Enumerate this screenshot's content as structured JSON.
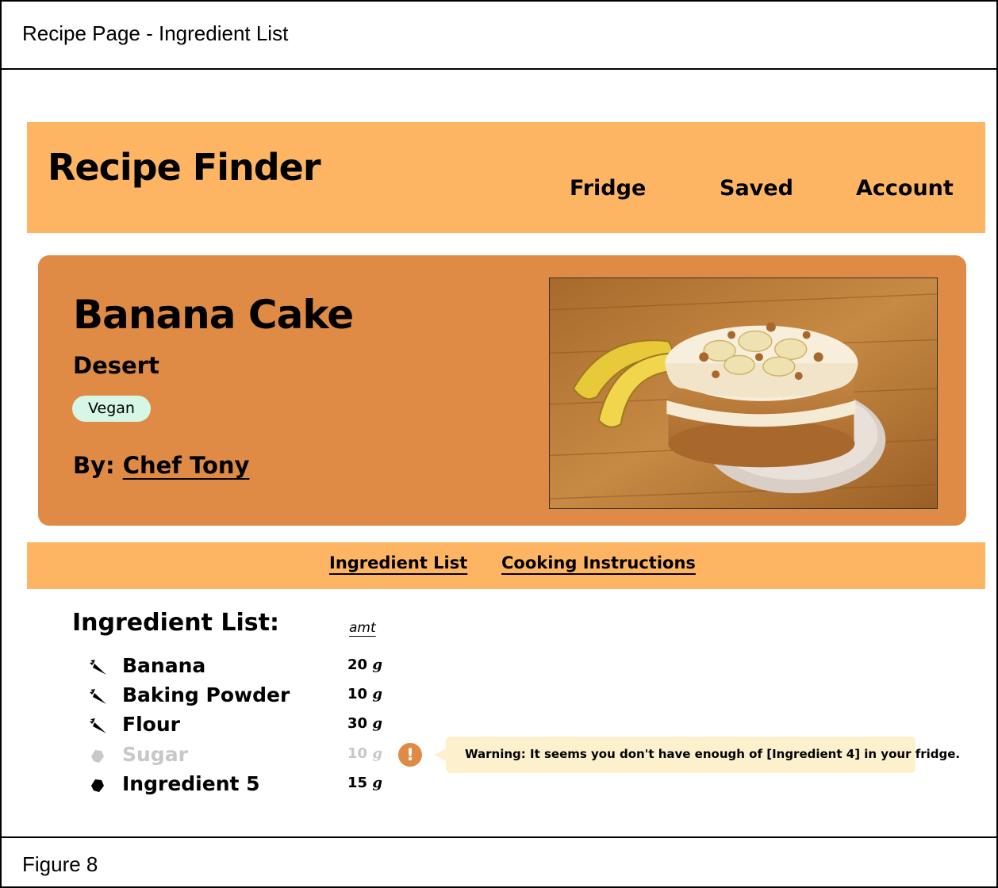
{
  "frame": {
    "title": "Recipe Page - Ingredient List",
    "caption": "Figure 8"
  },
  "navbar": {
    "brand": "Recipe Finder",
    "links": [
      "Fridge",
      "Saved",
      "Account"
    ]
  },
  "recipe": {
    "title": "Banana Cake",
    "category": "Desert",
    "tag": "Vegan",
    "byline_prefix": "By: ",
    "author": "Chef Tony",
    "photo_subject": "banana cake on plate with bananas"
  },
  "tabs": [
    "Ingredient List",
    "Cooking Instructions"
  ],
  "ingredients_section": {
    "heading": "Ingredient List:",
    "amount_header": "amt",
    "items": [
      {
        "name": "Banana",
        "amount": "20",
        "unit": "g",
        "icon": "carrot-icon",
        "available": true
      },
      {
        "name": "Baking Powder",
        "amount": "10",
        "unit": "g",
        "icon": "carrot-icon",
        "available": true
      },
      {
        "name": "Flour",
        "amount": "30",
        "unit": "g",
        "icon": "carrot-icon",
        "available": true
      },
      {
        "name": "Sugar",
        "amount": "10",
        "unit": "g",
        "icon": "ingredient-icon",
        "available": false
      },
      {
        "name": "Ingredient 5",
        "amount": "15",
        "unit": "g",
        "icon": "ingredient-icon",
        "available": true
      }
    ]
  },
  "warning": {
    "icon": "exclamation-icon",
    "symbol": "!",
    "text": "Warning: It seems you don't have enough of [Ingredient 4] in your fridge."
  },
  "colors": {
    "navbar_bg": "#fdb563",
    "hero_bg": "#e08b45",
    "tag_bg": "#d6f7e6",
    "tooltip_bg": "#fdf0cc",
    "unavailable_text": "#c8c8c8"
  }
}
